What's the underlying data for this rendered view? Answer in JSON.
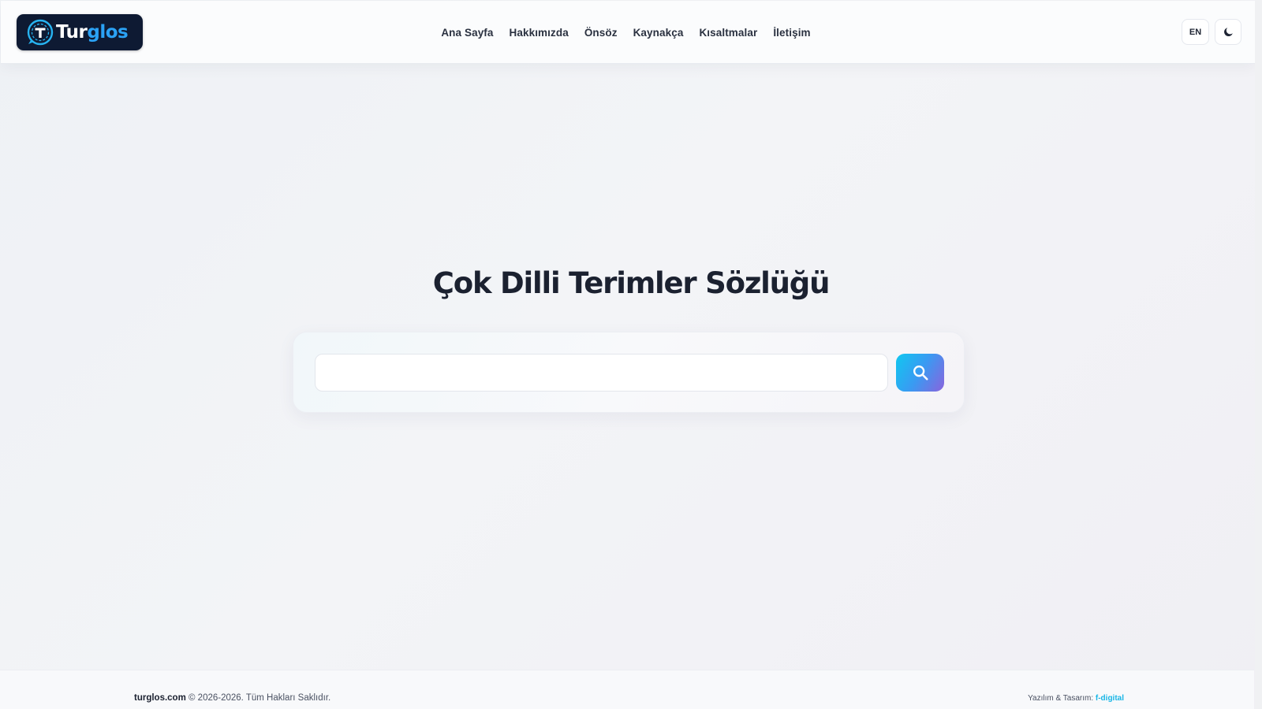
{
  "brand": {
    "name_part1": "Tur",
    "name_part2": "glos",
    "colors": {
      "logo_bg": "#0e1a33",
      "accent": "#2ba2f5"
    }
  },
  "nav": {
    "items": [
      {
        "label": "Ana Sayfa"
      },
      {
        "label": "Hakkımızda"
      },
      {
        "label": "Önsöz"
      },
      {
        "label": "Kaynakça"
      },
      {
        "label": "Kısaltmalar"
      },
      {
        "label": "İletişim"
      }
    ]
  },
  "header_actions": {
    "language_label": "EN",
    "theme_icon": "moon-icon"
  },
  "hero": {
    "title": "Çok Dilli Terimler Sözlüğü"
  },
  "search": {
    "value": "",
    "placeholder": "",
    "button_icon": "search-icon",
    "button_gradient": [
      "#10c7f0",
      "#3a9af2",
      "#8a63dd"
    ]
  },
  "footer": {
    "site": "turglos.com",
    "copyright": " © 2026-2026. Tüm Hakları Saklıdır.",
    "credit_label": "Yazılım & Tasarım: ",
    "credit_link": "f-digital",
    "credit_color": "#19b6e6"
  }
}
